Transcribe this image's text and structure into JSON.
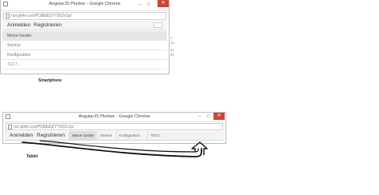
{
  "phone_window": {
    "title": "AngularJS Plunker - Google Chrome",
    "url": "run.plnkr.co/zPC88a5ZYY30Zv1p/",
    "nav": {
      "login": "Anmelden",
      "register": "Registrieren"
    },
    "menu": [
      {
        "label": "Meine Geräte",
        "active": true
      },
      {
        "label": "Service",
        "active": false
      },
      {
        "label": "Konfiguration",
        "active": false
      },
      {
        "label": "TEST...",
        "active": false
      }
    ],
    "window_controls": {
      "minimize": "–",
      "maximize": "□",
      "close": "✕"
    }
  },
  "label_smartphone": "Smartphone",
  "tablet_window": {
    "title": "AngularJS Plunker - Google Chrome",
    "url": "run.plnkr.co/zPC88a5ZYY30Zv1p/",
    "nav": {
      "login": "Anmelden",
      "register": "Registrieren"
    },
    "menu": [
      {
        "label": "Meine Geräte",
        "active": true
      },
      {
        "label": "Service",
        "active": false
      },
      {
        "label": "Konfiguration",
        "active": false
      },
      {
        "label": "TEST...",
        "active": false
      }
    ],
    "window_controls": {
      "minimize": "–",
      "maximize": "□",
      "close": "✕"
    }
  },
  "label_tablet": "Tablet",
  "colors": {
    "close": "#c9473d",
    "annotation": "#111111"
  }
}
